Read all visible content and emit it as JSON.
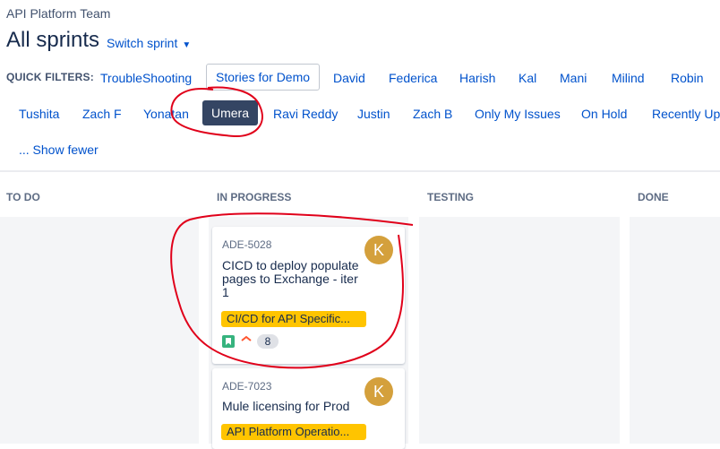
{
  "header": {
    "team": "API Platform Team",
    "title": "All sprints",
    "switch_label": "Switch sprint"
  },
  "quick_filters": {
    "label": "QUICK FILTERS:",
    "row1": [
      "TroubleShooting",
      "Stories for Demo",
      "David",
      "Federica",
      "Harish",
      "Kal",
      "Mani",
      "Milind",
      "Robin"
    ],
    "row2": [
      "Tushita",
      "Zach F",
      "Yonatan",
      "Umera",
      "Ravi Reddy",
      "Justin",
      "Zach B",
      "Only My Issues",
      "On Hold",
      "Recently Upd"
    ],
    "show_fewer": "... Show fewer",
    "boxed": "Stories for Demo",
    "selected": "Umera"
  },
  "columns": [
    "TO DO",
    "IN PROGRESS",
    "TESTING",
    "DONE"
  ],
  "cards": [
    {
      "key": "ADE-5028",
      "summary": "CICD to deploy populate pages to Exchange - iter 1",
      "epic": "CI/CD for API Specific...",
      "avatar": "K",
      "story_points": "8",
      "issue_type_icon": "story-icon",
      "priority_icon": "priority-high-icon"
    },
    {
      "key": "ADE-7023",
      "summary": "Mule licensing for Prod",
      "epic": "API Platform Operatio...",
      "avatar": "K"
    }
  ],
  "colors": {
    "link": "#0052cc",
    "selected_filter_bg": "#344563",
    "epic_bg": "#ffc400",
    "avatar_bg": "#d4a03c",
    "story_icon": "#36b37e",
    "annotation": "#e0001a"
  }
}
